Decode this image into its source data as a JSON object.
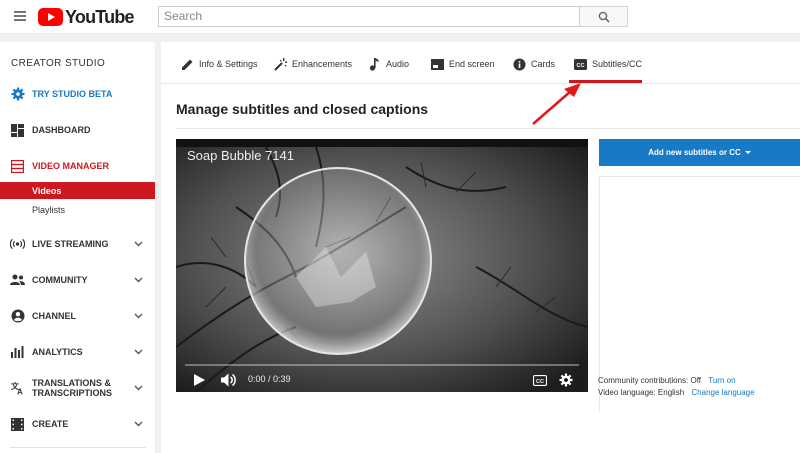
{
  "header": {
    "logo_text": "YouTube",
    "search_placeholder": "Search"
  },
  "sidebar": {
    "title": "CREATOR STUDIO",
    "items": [
      {
        "label": "TRY STUDIO BETA",
        "icon": "gear-icon",
        "color": "#167ac6"
      },
      {
        "label": "DASHBOARD",
        "icon": "dashboard-icon"
      },
      {
        "label": "VIDEO MANAGER",
        "icon": "video-manager-icon",
        "color": "#cc181e"
      },
      {
        "label": "LIVE STREAMING",
        "icon": "broadcast-icon"
      },
      {
        "label": "COMMUNITY",
        "icon": "people-icon"
      },
      {
        "label": "CHANNEL",
        "icon": "account-icon"
      },
      {
        "label": "ANALYTICS",
        "icon": "bar-chart-icon"
      },
      {
        "label_line1": "TRANSLATIONS &",
        "label_line2": "TRANSCRIPTIONS",
        "icon": "translate-icon"
      },
      {
        "label": "CREATE",
        "icon": "movie-icon"
      }
    ],
    "video_manager_sub": [
      {
        "label": "Videos",
        "active": true
      },
      {
        "label": "Playlists",
        "active": false
      }
    ]
  },
  "tabs": [
    {
      "label": "Info & Settings",
      "icon": "pencil-icon"
    },
    {
      "label": "Enhancements",
      "icon": "magic-wand-icon"
    },
    {
      "label": "Audio",
      "icon": "music-note-icon"
    },
    {
      "label": "End screen",
      "icon": "end-screen-icon"
    },
    {
      "label": "Cards",
      "icon": "info-icon"
    },
    {
      "label": "Subtitles/CC",
      "icon": "cc-icon",
      "active": true
    }
  ],
  "page_title": "Manage subtitles and closed captions",
  "player": {
    "title": "Soap Bubble 7141",
    "time": "0:00 / 0:39",
    "progress": 0
  },
  "panel": {
    "add_button": "Add new subtitles or CC",
    "community_label": "Community contributions: Off",
    "community_link": "Turn on",
    "language_label": "Video language: English",
    "language_link": "Change language"
  },
  "colors": {
    "accent_blue": "#167ac6",
    "accent_red": "#cc181e",
    "annotation_arrow": "#e3161b"
  }
}
